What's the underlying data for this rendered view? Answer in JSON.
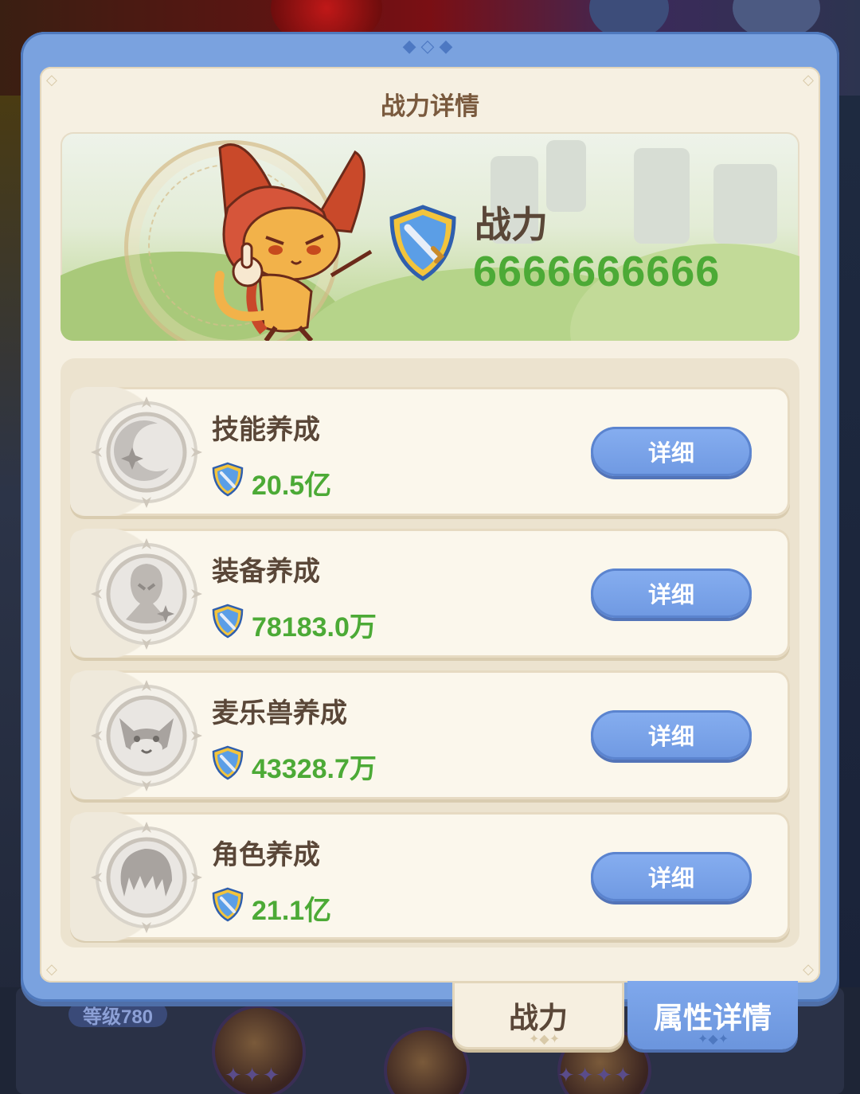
{
  "modal": {
    "title": "战力详情",
    "power_label": "战力",
    "power_value": "6666666666"
  },
  "cards": [
    {
      "title": "技能养成",
      "value": "20.5亿",
      "button": "详细",
      "icon": "crescent-moon-sparkle-icon"
    },
    {
      "title": "装备养成",
      "value": "78183.0万",
      "button": "详细",
      "icon": "hooded-figure-sparkle-icon"
    },
    {
      "title": "麦乐兽养成",
      "value": "43328.7万",
      "button": "详细",
      "icon": "cat-face-icon"
    },
    {
      "title": "角色养成",
      "value": "21.1亿",
      "button": "详细",
      "icon": "character-hair-icon"
    }
  ],
  "tabs": {
    "power": "战力",
    "attributes": "属性详情"
  },
  "background": {
    "level_badge": "等级780"
  },
  "colors": {
    "frame": "#7aa2df",
    "panel": "#f6f0e2",
    "value_green": "#4caa36",
    "title_brown": "#5a4738",
    "button_blue": "#7aa2e8"
  }
}
